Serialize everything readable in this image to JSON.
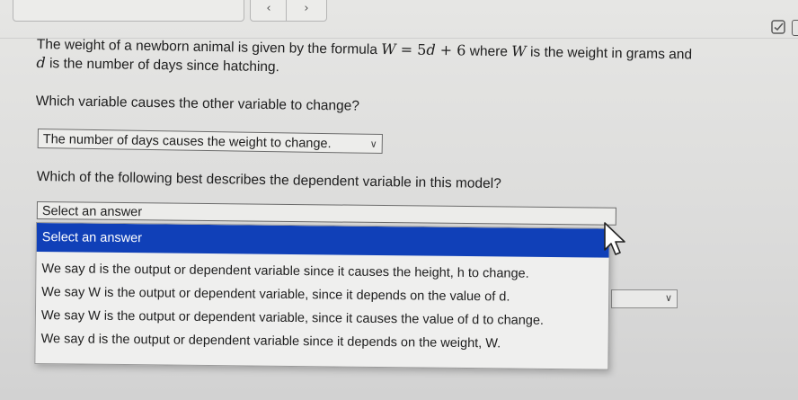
{
  "nav": {
    "prev_icon": "chevron-left-icon",
    "prev_glyph": "‹",
    "next_icon": "chevron-right-icon",
    "next_glyph": "›"
  },
  "question": {
    "text_a": "The weight of a newborn animal is given by the formula ",
    "formula_w": "W",
    "formula_eq": " = 5",
    "formula_d": "d",
    "formula_rest": " + 6",
    "text_b": " where ",
    "w_var": "W",
    "text_c": " is the weight in grams and",
    "d_var": "d",
    "text_d": " is the number of days since hatching."
  },
  "q1": {
    "prompt": "Which variable causes the other variable to change?",
    "selected": "The number of days causes the weight to change."
  },
  "q2": {
    "prompt": "Which of the following best describes the dependent variable in this model?",
    "selected": "Select an answer",
    "options": [
      "Select an answer",
      "We say d is the output or dependent variable since it causes the height, h to change.",
      "We say W is the output or dependent variable, since it depends on the value of d.",
      "We say W is the output or dependent variable, since it causes the value of d to change.",
      "We say d is the output or dependent variable since it depends on the weight, W."
    ]
  },
  "icons": {
    "chevron": "chevron-down-icon",
    "check": "checkbox-icon"
  },
  "colors": {
    "highlight": "#1040b8",
    "highlight_text": "#ffffff"
  }
}
